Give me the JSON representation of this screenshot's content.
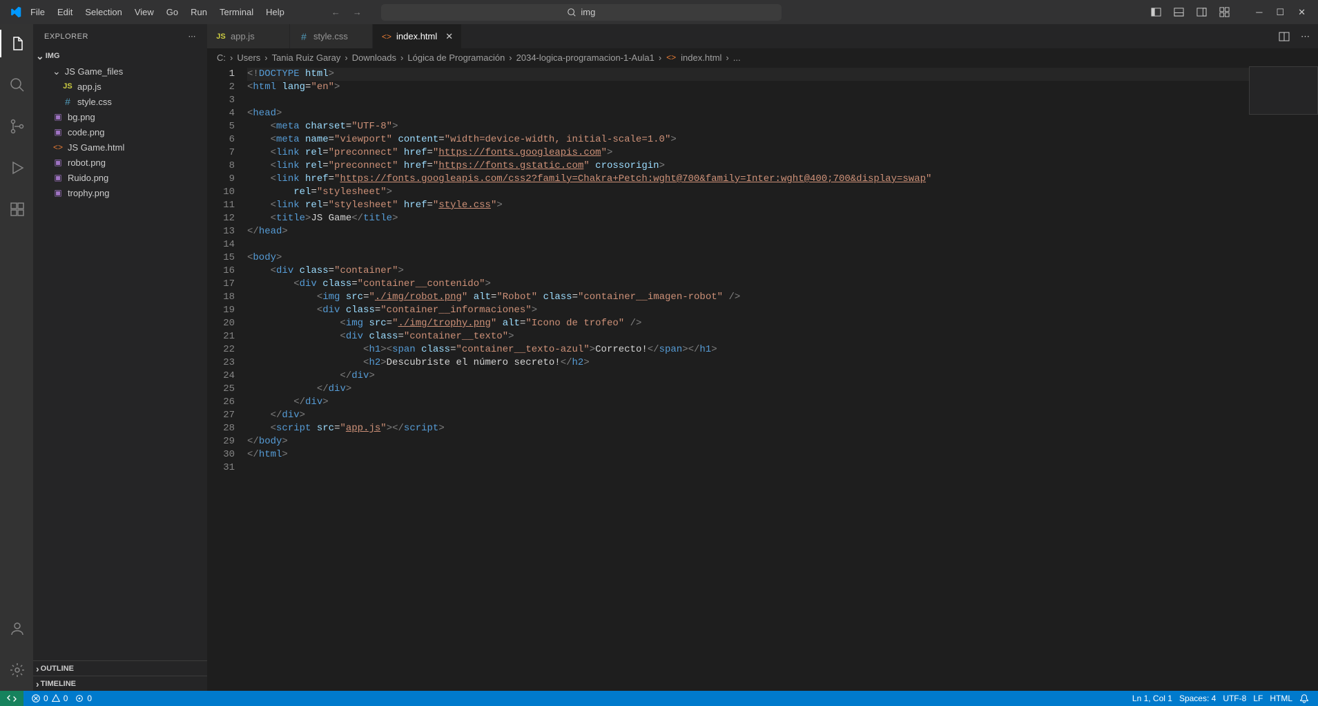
{
  "menu": [
    "File",
    "Edit",
    "Selection",
    "View",
    "Go",
    "Run",
    "Terminal",
    "Help"
  ],
  "search": {
    "text": "img"
  },
  "sidebar": {
    "title": "EXPLORER",
    "root": "IMG",
    "folder": "JS Game_files",
    "items": [
      {
        "kind": "js",
        "name": "app.js"
      },
      {
        "kind": "css",
        "name": "style.css"
      }
    ],
    "files": [
      {
        "kind": "img",
        "name": "bg.png"
      },
      {
        "kind": "img",
        "name": "code.png"
      },
      {
        "kind": "html",
        "name": "JS Game.html"
      },
      {
        "kind": "img",
        "name": "robot.png"
      },
      {
        "kind": "img",
        "name": "Ruido.png"
      },
      {
        "kind": "img",
        "name": "trophy.png"
      }
    ],
    "sections": {
      "outline": "OUTLINE",
      "timeline": "TIMELINE"
    }
  },
  "tabs": [
    {
      "kind": "js",
      "name": "app.js"
    },
    {
      "kind": "css",
      "name": "style.css"
    },
    {
      "kind": "html",
      "name": "index.html",
      "active": true
    }
  ],
  "breadcrumb": [
    "C:",
    "Users",
    "Tania Ruiz Garay",
    "Downloads",
    "Lógica de Programación",
    "2034-logica-programacion-1-Aula1",
    "",
    "index.html",
    "..."
  ],
  "code": {
    "lines": 31
  },
  "status": {
    "errors": "0",
    "warnings": "0",
    "ports": "0",
    "pos": "Ln 1, Col 1",
    "spaces": "Spaces: 4",
    "encoding": "UTF-8",
    "eol": "LF",
    "lang": "HTML"
  }
}
